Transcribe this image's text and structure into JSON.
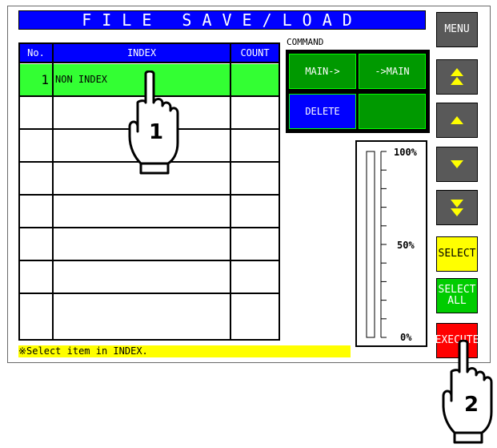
{
  "title": "FILE SAVE/LOAD",
  "table": {
    "headers": {
      "no": "No.",
      "index": "INDEX",
      "count": "COUNT"
    },
    "rows": [
      {
        "no": "1",
        "index": "NON INDEX",
        "count": "",
        "selected": true
      },
      {
        "no": "",
        "index": "",
        "count": "",
        "selected": false
      },
      {
        "no": "",
        "index": "",
        "count": "",
        "selected": false
      },
      {
        "no": "",
        "index": "",
        "count": "",
        "selected": false
      },
      {
        "no": "",
        "index": "",
        "count": "",
        "selected": false
      },
      {
        "no": "",
        "index": "",
        "count": "",
        "selected": false
      },
      {
        "no": "",
        "index": "",
        "count": "",
        "selected": false
      },
      {
        "no": "",
        "index": "",
        "count": "",
        "selected": false
      }
    ]
  },
  "command": {
    "label": "COMMAND",
    "main_to": "MAIN->",
    "to_main": "->MAIN",
    "delete": "DELETE",
    "empty": ""
  },
  "gauge": {
    "top_label": "100%",
    "mid_label": "50%",
    "bottom_label": "0%",
    "fill_fraction": 0
  },
  "side": {
    "menu": "MENU",
    "page_up_icon": "double-up-arrow",
    "up_icon": "up-arrow",
    "down_icon": "down-arrow",
    "page_down_icon": "double-down-arrow",
    "select": "SELECT",
    "select_all": "SELECT\nALL",
    "execute": "EXECUTE"
  },
  "status": "※Select item in INDEX.",
  "callouts": {
    "step1": "1",
    "step2": "2"
  },
  "colors": {
    "title_bg": "#0000ff",
    "selected_row": "#33ff33",
    "command_green": "#009900",
    "delete_blue": "#0000ff",
    "select_yellow": "#ffff00",
    "select_all_green": "#00cc00",
    "execute_red": "#ff0000",
    "nav_gray": "#595959",
    "arrow_yellow": "#ffff00"
  }
}
